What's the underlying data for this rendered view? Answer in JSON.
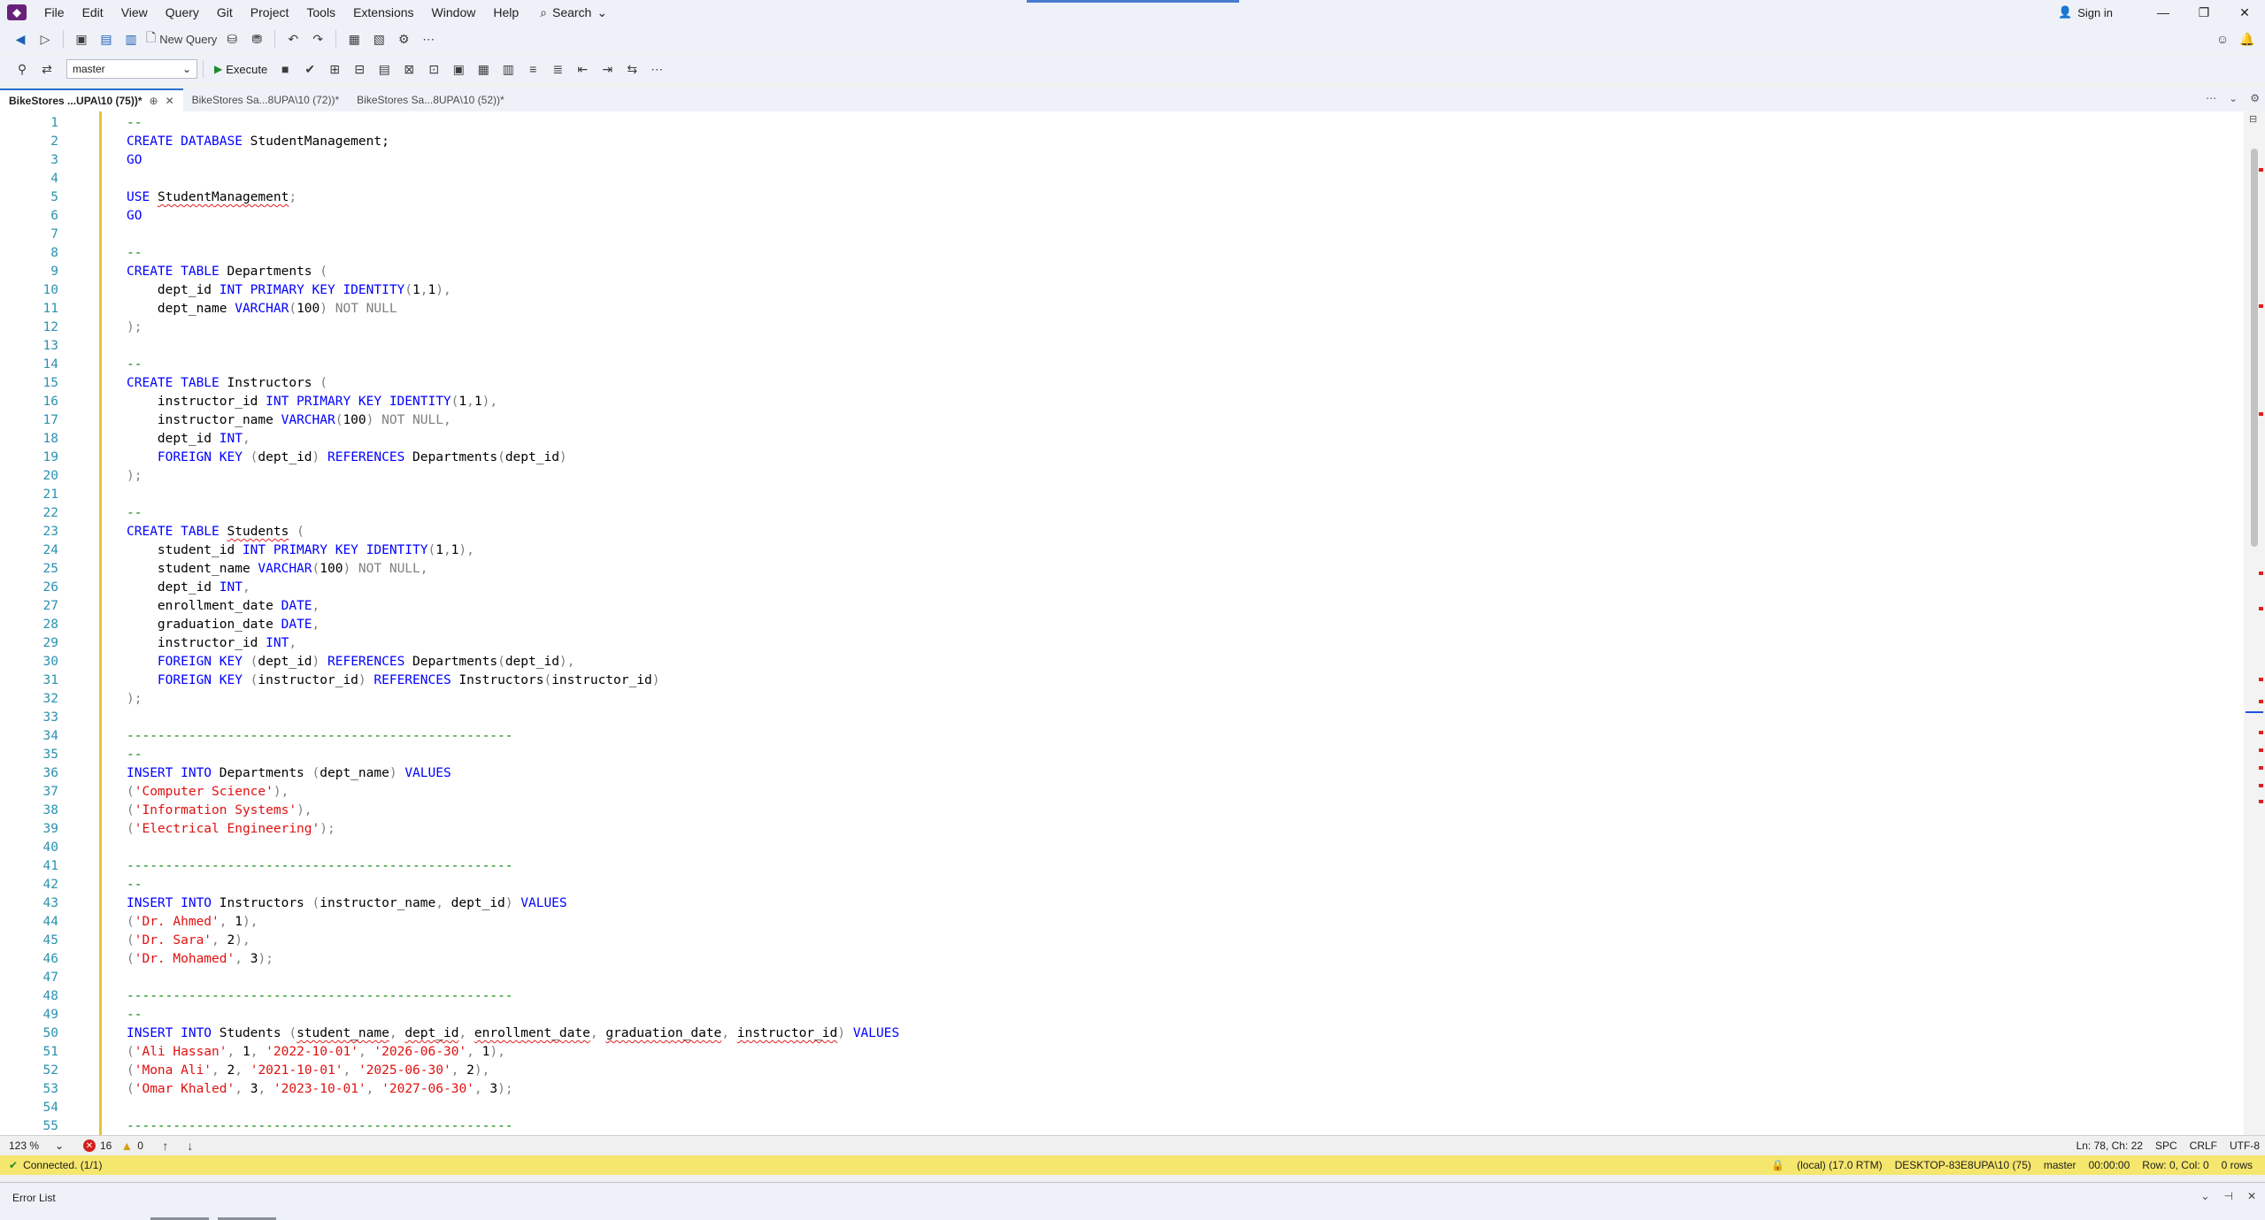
{
  "menu": {
    "items": [
      "File",
      "Edit",
      "View",
      "Query",
      "Git",
      "Project",
      "Tools",
      "Extensions",
      "Window",
      "Help"
    ],
    "search_label": "Search",
    "sign_in": "Sign in"
  },
  "toolbar": {
    "new_query": "New Query",
    "database": "master",
    "execute": "Execute"
  },
  "tabs": [
    {
      "label": "BikeStores ...UPA\\10 (75))*",
      "active": true
    },
    {
      "label": "BikeStores Sa...8UPA\\10 (72))*",
      "active": false
    },
    {
      "label": "BikeStores Sa...8UPA\\10 (52))*",
      "active": false
    }
  ],
  "editor": {
    "line_numbers": [
      "1",
      "2",
      "3",
      "4",
      "5",
      "6",
      "7",
      "8",
      "9",
      "10",
      "11",
      "12",
      "13",
      "14",
      "15",
      "16",
      "17",
      "18",
      "19",
      "20",
      "21",
      "22",
      "23",
      "24",
      "25",
      "26",
      "27",
      "28",
      "29",
      "30",
      "31",
      "32",
      "33",
      "34",
      "35",
      "36",
      "37",
      "38",
      "39",
      "40",
      "41",
      "42",
      "43",
      "44",
      "45",
      "46",
      "47",
      "48",
      "49",
      "50",
      "51",
      "52",
      "53",
      "54",
      "55"
    ],
    "lines": [
      [
        {
          "t": "-- ",
          "c": "cm"
        }
      ],
      [
        {
          "t": "CREATE DATABASE",
          "c": "kw"
        },
        {
          "t": " StudentManagement;"
        }
      ],
      [
        {
          "t": "GO",
          "c": "kw"
        }
      ],
      [],
      [
        {
          "t": "USE",
          "c": "kw"
        },
        {
          "t": " "
        },
        {
          "t": "StudentManagement",
          "s": 1
        },
        {
          "t": ";",
          "c": "gr"
        }
      ],
      [
        {
          "t": "GO",
          "c": "kw"
        }
      ],
      [],
      [
        {
          "t": "-- ",
          "c": "cm"
        }
      ],
      [
        {
          "t": "CREATE TABLE",
          "c": "kw"
        },
        {
          "t": " Departments "
        },
        {
          "t": "(",
          "c": "gr"
        }
      ],
      [
        {
          "t": "    dept_id "
        },
        {
          "t": "INT PRIMARY KEY IDENTITY",
          "c": "kw"
        },
        {
          "t": "(",
          "c": "gr"
        },
        {
          "t": "1"
        },
        {
          "t": ",",
          "c": "gr"
        },
        {
          "t": "1"
        },
        {
          "t": "),",
          "c": "gr"
        }
      ],
      [
        {
          "t": "    dept_name "
        },
        {
          "t": "VARCHAR",
          "c": "kw"
        },
        {
          "t": "(",
          "c": "gr"
        },
        {
          "t": "100"
        },
        {
          "t": ")",
          "c": "gr"
        },
        {
          "t": " NOT NULL",
          "c": "gr"
        }
      ],
      [
        {
          "t": ");",
          "c": "gr"
        }
      ],
      [],
      [
        {
          "t": "-- ",
          "c": "cm"
        }
      ],
      [
        {
          "t": "CREATE TABLE",
          "c": "kw"
        },
        {
          "t": " Instructors "
        },
        {
          "t": "(",
          "c": "gr"
        }
      ],
      [
        {
          "t": "    instructor_id "
        },
        {
          "t": "INT PRIMARY KEY IDENTITY",
          "c": "kw"
        },
        {
          "t": "(",
          "c": "gr"
        },
        {
          "t": "1"
        },
        {
          "t": ",",
          "c": "gr"
        },
        {
          "t": "1"
        },
        {
          "t": "),",
          "c": "gr"
        }
      ],
      [
        {
          "t": "    instructor_name "
        },
        {
          "t": "VARCHAR",
          "c": "kw"
        },
        {
          "t": "(",
          "c": "gr"
        },
        {
          "t": "100"
        },
        {
          "t": ")",
          "c": "gr"
        },
        {
          "t": " NOT NULL,",
          "c": "gr"
        }
      ],
      [
        {
          "t": "    dept_id "
        },
        {
          "t": "INT",
          "c": "kw"
        },
        {
          "t": ",",
          "c": "gr"
        }
      ],
      [
        {
          "t": "    "
        },
        {
          "t": "FOREIGN KEY",
          "c": "kw"
        },
        {
          "t": " (",
          "c": "gr"
        },
        {
          "t": "dept_id"
        },
        {
          "t": ")",
          "c": "gr"
        },
        {
          "t": " "
        },
        {
          "t": "REFERENCES",
          "c": "kw"
        },
        {
          "t": " Departments"
        },
        {
          "t": "(",
          "c": "gr"
        },
        {
          "t": "dept_id"
        },
        {
          "t": ")",
          "c": "gr"
        }
      ],
      [
        {
          "t": ");",
          "c": "gr"
        }
      ],
      [],
      [
        {
          "t": "-- ",
          "c": "cm"
        }
      ],
      [
        {
          "t": "CREATE TABLE",
          "c": "kw"
        },
        {
          "t": " "
        },
        {
          "t": "Students",
          "s": 1
        },
        {
          "t": " "
        },
        {
          "t": "(",
          "c": "gr"
        }
      ],
      [
        {
          "t": "    student_id "
        },
        {
          "t": "INT PRIMARY KEY IDENTITY",
          "c": "kw"
        },
        {
          "t": "(",
          "c": "gr"
        },
        {
          "t": "1"
        },
        {
          "t": ",",
          "c": "gr"
        },
        {
          "t": "1"
        },
        {
          "t": "),",
          "c": "gr"
        }
      ],
      [
        {
          "t": "    student_name "
        },
        {
          "t": "VARCHAR",
          "c": "kw"
        },
        {
          "t": "(",
          "c": "gr"
        },
        {
          "t": "100"
        },
        {
          "t": ")",
          "c": "gr"
        },
        {
          "t": " NOT NULL,",
          "c": "gr"
        }
      ],
      [
        {
          "t": "    dept_id "
        },
        {
          "t": "INT",
          "c": "kw"
        },
        {
          "t": ",",
          "c": "gr"
        }
      ],
      [
        {
          "t": "    enrollment_date "
        },
        {
          "t": "DATE",
          "c": "kw"
        },
        {
          "t": ",",
          "c": "gr"
        }
      ],
      [
        {
          "t": "    graduation_date "
        },
        {
          "t": "DATE",
          "c": "kw"
        },
        {
          "t": ",",
          "c": "gr"
        }
      ],
      [
        {
          "t": "    instructor_id "
        },
        {
          "t": "INT",
          "c": "kw"
        },
        {
          "t": ",",
          "c": "gr"
        }
      ],
      [
        {
          "t": "    "
        },
        {
          "t": "FOREIGN KEY",
          "c": "kw"
        },
        {
          "t": " (",
          "c": "gr"
        },
        {
          "t": "dept_id"
        },
        {
          "t": ")",
          "c": "gr"
        },
        {
          "t": " "
        },
        {
          "t": "REFERENCES",
          "c": "kw"
        },
        {
          "t": " Departments"
        },
        {
          "t": "(",
          "c": "gr"
        },
        {
          "t": "dept_id"
        },
        {
          "t": "),",
          "c": "gr"
        }
      ],
      [
        {
          "t": "    "
        },
        {
          "t": "FOREIGN KEY",
          "c": "kw"
        },
        {
          "t": " (",
          "c": "gr"
        },
        {
          "t": "instructor_id"
        },
        {
          "t": ")",
          "c": "gr"
        },
        {
          "t": " "
        },
        {
          "t": "REFERENCES",
          "c": "kw"
        },
        {
          "t": " Instructors"
        },
        {
          "t": "(",
          "c": "gr"
        },
        {
          "t": "instructor_id"
        },
        {
          "t": ")",
          "c": "gr"
        }
      ],
      [
        {
          "t": ");",
          "c": "gr"
        }
      ],
      [],
      [
        {
          "t": "--------------------------------------------------",
          "c": "cm"
        }
      ],
      [
        {
          "t": "-- ",
          "c": "cm"
        }
      ],
      [
        {
          "t": "INSERT INTO",
          "c": "kw"
        },
        {
          "t": " Departments "
        },
        {
          "t": "(",
          "c": "gr"
        },
        {
          "t": "dept_name"
        },
        {
          "t": ")",
          "c": "gr"
        },
        {
          "t": " "
        },
        {
          "t": "VALUES",
          "c": "kw"
        }
      ],
      [
        {
          "t": "(",
          "c": "gr"
        },
        {
          "t": "'Computer Science'",
          "c": "str"
        },
        {
          "t": "),",
          "c": "gr"
        }
      ],
      [
        {
          "t": "(",
          "c": "gr"
        },
        {
          "t": "'Information Systems'",
          "c": "str"
        },
        {
          "t": "),",
          "c": "gr"
        }
      ],
      [
        {
          "t": "(",
          "c": "gr"
        },
        {
          "t": "'Electrical Engineering'",
          "c": "str"
        },
        {
          "t": ");",
          "c": "gr"
        }
      ],
      [],
      [
        {
          "t": "--------------------------------------------------",
          "c": "cm"
        }
      ],
      [
        {
          "t": "-- ",
          "c": "cm"
        }
      ],
      [
        {
          "t": "INSERT INTO",
          "c": "kw"
        },
        {
          "t": " Instructors "
        },
        {
          "t": "(",
          "c": "gr"
        },
        {
          "t": "instructor_name"
        },
        {
          "t": ",",
          "c": "gr"
        },
        {
          "t": " dept_id"
        },
        {
          "t": ")",
          "c": "gr"
        },
        {
          "t": " "
        },
        {
          "t": "VALUES",
          "c": "kw"
        }
      ],
      [
        {
          "t": "(",
          "c": "gr"
        },
        {
          "t": "'Dr. Ahmed'",
          "c": "str"
        },
        {
          "t": ",",
          "c": "gr"
        },
        {
          "t": " 1"
        },
        {
          "t": "),",
          "c": "gr"
        }
      ],
      [
        {
          "t": "(",
          "c": "gr"
        },
        {
          "t": "'Dr. Sara'",
          "c": "str"
        },
        {
          "t": ",",
          "c": "gr"
        },
        {
          "t": " 2"
        },
        {
          "t": "),",
          "c": "gr"
        }
      ],
      [
        {
          "t": "(",
          "c": "gr"
        },
        {
          "t": "'Dr. Mohamed'",
          "c": "str"
        },
        {
          "t": ",",
          "c": "gr"
        },
        {
          "t": " 3"
        },
        {
          "t": ");",
          "c": "gr"
        }
      ],
      [],
      [
        {
          "t": "--------------------------------------------------",
          "c": "cm"
        }
      ],
      [
        {
          "t": "-- ",
          "c": "cm"
        }
      ],
      [
        {
          "t": "INSERT INTO",
          "c": "kw"
        },
        {
          "t": " Students "
        },
        {
          "t": "(",
          "c": "gr"
        },
        {
          "t": "student_name",
          "s": 1
        },
        {
          "t": ",",
          "c": "gr"
        },
        {
          "t": " "
        },
        {
          "t": "dept_id",
          "s": 1
        },
        {
          "t": ",",
          "c": "gr"
        },
        {
          "t": " "
        },
        {
          "t": "enrollment_date",
          "s": 1
        },
        {
          "t": ",",
          "c": "gr"
        },
        {
          "t": " "
        },
        {
          "t": "graduation_date",
          "s": 1
        },
        {
          "t": ",",
          "c": "gr"
        },
        {
          "t": " "
        },
        {
          "t": "instructor_id",
          "s": 1
        },
        {
          "t": ")",
          "c": "gr"
        },
        {
          "t": " "
        },
        {
          "t": "VALUES",
          "c": "kw"
        }
      ],
      [
        {
          "t": "(",
          "c": "gr"
        },
        {
          "t": "'Ali Hassan'",
          "c": "str"
        },
        {
          "t": ",",
          "c": "gr"
        },
        {
          "t": " 1"
        },
        {
          "t": ",",
          "c": "gr"
        },
        {
          "t": " "
        },
        {
          "t": "'2022-10-01'",
          "c": "str"
        },
        {
          "t": ",",
          "c": "gr"
        },
        {
          "t": " "
        },
        {
          "t": "'2026-06-30'",
          "c": "str"
        },
        {
          "t": ",",
          "c": "gr"
        },
        {
          "t": " 1"
        },
        {
          "t": "),",
          "c": "gr"
        }
      ],
      [
        {
          "t": "(",
          "c": "gr"
        },
        {
          "t": "'Mona Ali'",
          "c": "str"
        },
        {
          "t": ",",
          "c": "gr"
        },
        {
          "t": " 2"
        },
        {
          "t": ",",
          "c": "gr"
        },
        {
          "t": " "
        },
        {
          "t": "'2021-10-01'",
          "c": "str"
        },
        {
          "t": ",",
          "c": "gr"
        },
        {
          "t": " "
        },
        {
          "t": "'2025-06-30'",
          "c": "str"
        },
        {
          "t": ",",
          "c": "gr"
        },
        {
          "t": " 2"
        },
        {
          "t": "),",
          "c": "gr"
        }
      ],
      [
        {
          "t": "(",
          "c": "gr"
        },
        {
          "t": "'Omar Khaled'",
          "c": "str"
        },
        {
          "t": ",",
          "c": "gr"
        },
        {
          "t": " 3"
        },
        {
          "t": ",",
          "c": "gr"
        },
        {
          "t": " "
        },
        {
          "t": "'2023-10-01'",
          "c": "str"
        },
        {
          "t": ",",
          "c": "gr"
        },
        {
          "t": " "
        },
        {
          "t": "'2027-06-30'",
          "c": "str"
        },
        {
          "t": ",",
          "c": "gr"
        },
        {
          "t": " 3"
        },
        {
          "t": ");",
          "c": "gr"
        }
      ],
      [],
      [
        {
          "t": "--------------------------------------------------",
          "c": "cm"
        }
      ]
    ]
  },
  "zoombar": {
    "zoom": "123 %",
    "errors": "16",
    "warnings": "0",
    "position": "Ln: 78, Ch: 22",
    "spacing": "SPC",
    "line_ending": "CRLF",
    "encoding": "UTF-8"
  },
  "connection": {
    "status": "Connected. (1/1)",
    "server": "(local) (17.0 RTM)",
    "machine": "DESKTOP-83E8UPA\\10 (75)",
    "database": "master",
    "elapsed": "00:00:00",
    "cursor": "Row: 0, Col: 0",
    "rows": "0 rows"
  },
  "error_list": {
    "title": "Error List"
  },
  "watermark": {
    "text": "",
    "sub": ""
  },
  "colors": {
    "keyword": "#0000ff",
    "string": "#e01010",
    "comment": "#008000",
    "gutter": "#2b91af",
    "status_bar": "#f5e66e",
    "accent": "#2a6ec9"
  },
  "icons": [
    "ssms-logo",
    "search-icon",
    "sign-in-icon",
    "minimize-icon",
    "restore-icon",
    "close-icon",
    "execute-icon",
    "error-icon",
    "warning-icon",
    "connected-icon",
    "lock-icon"
  ]
}
